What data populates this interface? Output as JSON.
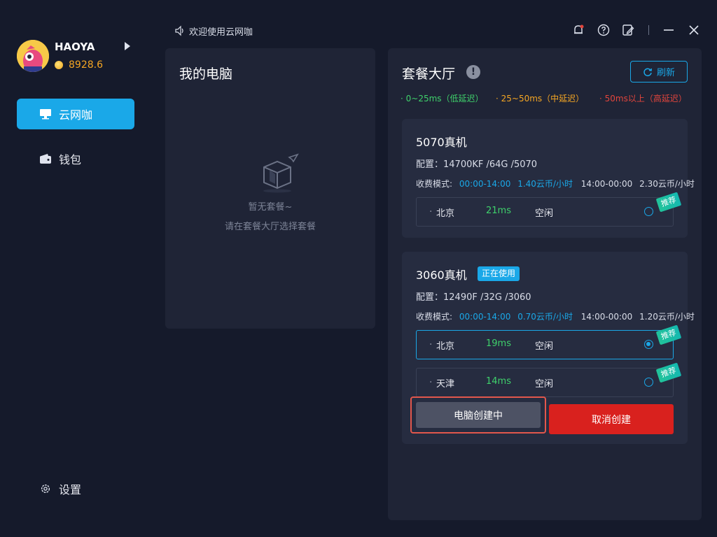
{
  "user": {
    "name": "HAOYA",
    "coins": "8928.6"
  },
  "sidebar": {
    "items": [
      {
        "label": "云网咖",
        "icon": "monitor-icon"
      },
      {
        "label": "钱包",
        "icon": "wallet-icon"
      },
      {
        "label": "设置",
        "icon": "gear-icon"
      }
    ]
  },
  "topbar": {
    "announcement": "欢迎使用云网咖"
  },
  "my_pc": {
    "title": "我的电脑",
    "empty_title": "暂无套餐~",
    "empty_subtitle": "请在套餐大厅选择套餐"
  },
  "hall": {
    "title": "套餐大厅",
    "refresh_label": "刷新",
    "legend": [
      {
        "text": "· 0~25ms（低延迟）",
        "color": "#3fd16b"
      },
      {
        "text": "· 25~50ms（中延迟）",
        "color": "#f5a623"
      },
      {
        "text": "· 50ms以上（高延迟）",
        "color": "#e2453c"
      }
    ],
    "packages": [
      {
        "name": "5070真机",
        "badge": "",
        "spec": "配置：14700KF /64G /5070",
        "fee_label": "收费模式:",
        "fee_time1": "00:00-14:00",
        "fee_price1": "1.40云币/小时",
        "fee_time2": "14:00-00:00",
        "fee_price2": "2.30云币/小时",
        "servers": [
          {
            "name": "北京",
            "ping": "21ms",
            "status": "空闲",
            "recommend": "推荐",
            "selected": false
          }
        ]
      },
      {
        "name": "3060真机",
        "badge": "正在使用",
        "spec": "配置：12490F /32G /3060",
        "fee_label": "收费模式:",
        "fee_time1": "00:00-14:00",
        "fee_price1": "0.70云币/小时",
        "fee_time2": "14:00-00:00",
        "fee_price2": "1.20云币/小时",
        "servers": [
          {
            "name": "北京",
            "ping": "19ms",
            "status": "空闲",
            "recommend": "推荐",
            "selected": true
          },
          {
            "name": "天津",
            "ping": "14ms",
            "status": "空闲",
            "recommend": "推荐",
            "selected": false
          }
        ],
        "creating_label": "电脑创建中",
        "cancel_label": "取消创建"
      }
    ]
  },
  "colors": {
    "accent": "#1aa8e8",
    "danger": "#d9211e",
    "coin": "#f5a623",
    "ping_good": "#3fd16b"
  }
}
